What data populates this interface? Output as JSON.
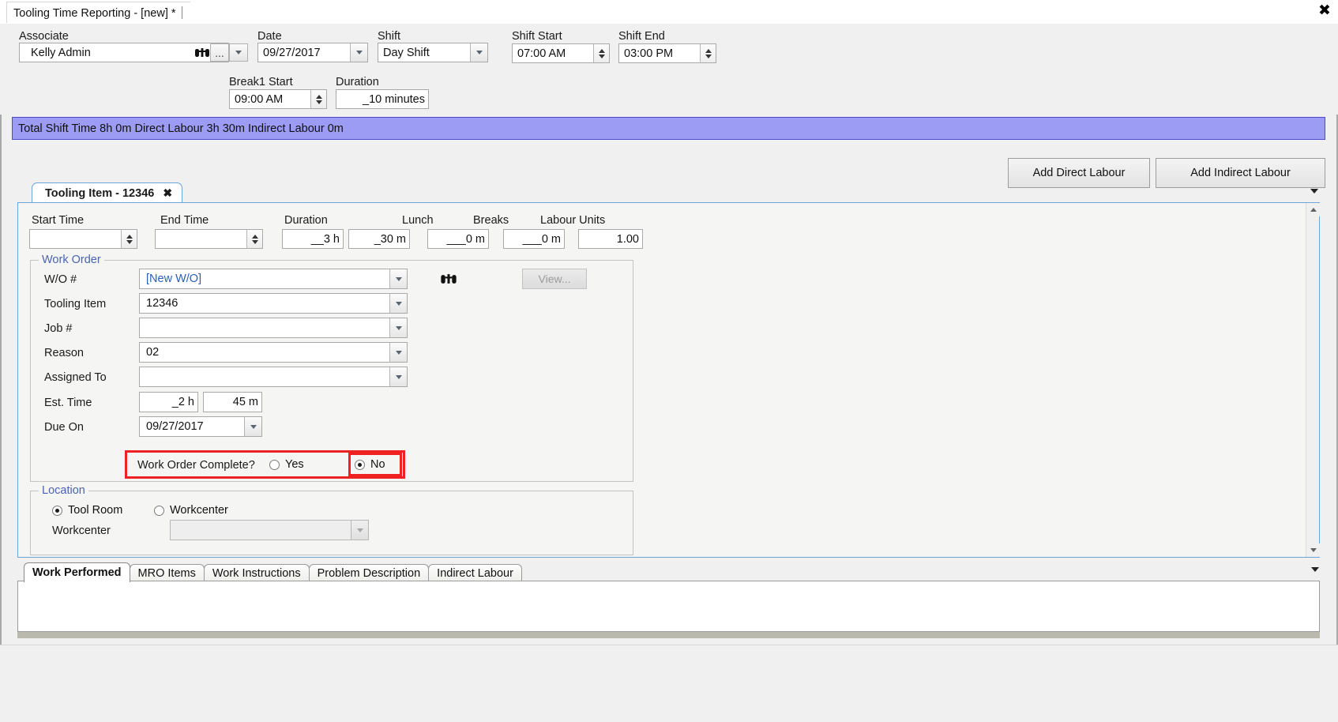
{
  "window": {
    "tab_title": "Tooling Time Reporting - [new] *",
    "close_icon": "close-icon"
  },
  "header": {
    "associate": {
      "label": "Associate",
      "value": "Kelly Admin",
      "search_icon": "binoculars-icon",
      "ellipsis_button": "...",
      "dropdown_icon": "chevron-down-icon"
    },
    "date": {
      "label": "Date",
      "value": "09/27/2017"
    },
    "shift": {
      "label": "Shift",
      "value": "Day Shift"
    },
    "shift_start": {
      "label": "Shift Start",
      "value": "07:00 AM"
    },
    "shift_end": {
      "label": "Shift End",
      "value": "03:00 PM"
    },
    "break1_start": {
      "label": "Break1 Start",
      "value": "09:00 AM"
    },
    "break1_duration": {
      "label": "Duration",
      "value": "_10 minutes"
    }
  },
  "summary": {
    "text": "Total Shift Time 8h 0m  Direct Labour 3h 30m  Indirect Labour 0m",
    "color": "#9c9cf5"
  },
  "actions": {
    "add_direct_labour": "Add Direct Labour",
    "add_indirect_labour": "Add Indirect Labour"
  },
  "item_tab": {
    "label": "Tooling Item - 12346",
    "close_glyph": "✖"
  },
  "time_row": {
    "start_time": {
      "label": "Start Time",
      "value": ""
    },
    "end_time": {
      "label": "End Time",
      "value": ""
    },
    "duration": {
      "label": "Duration",
      "hours": "__3 h",
      "minutes": "_30 m"
    },
    "lunch": {
      "label": "Lunch",
      "value": "___0 m"
    },
    "breaks": {
      "label": "Breaks",
      "value": "___0 m"
    },
    "labour_units": {
      "label": "Labour Units",
      "value": "1.00"
    }
  },
  "work_order": {
    "group_title": "Work Order",
    "wo_number": {
      "label": "W/O #",
      "value": "[New W/O]",
      "value_color": "#2c5fb8"
    },
    "search_icon": "binoculars-icon",
    "view_button": {
      "label": "View...",
      "enabled": false
    },
    "tooling_item": {
      "label": "Tooling Item",
      "value": "12346"
    },
    "job_number": {
      "label": "Job #",
      "value": ""
    },
    "reason": {
      "label": "Reason",
      "value": "02"
    },
    "assigned_to": {
      "label": "Assigned To",
      "value": ""
    },
    "est_time": {
      "label": "Est. Time",
      "hours": "_2 h",
      "minutes": "45 m"
    },
    "due_on": {
      "label": "Due On",
      "value": "09/27/2017"
    },
    "complete": {
      "label": "Work Order Complete?",
      "yes_label": "Yes",
      "no_label": "No",
      "selected": "No",
      "highlight_color": "#ee2222"
    }
  },
  "location": {
    "group_title": "Location",
    "tool_room": "Tool Room",
    "workcenter_radio": "Workcenter",
    "selected": "Tool Room",
    "workcenter_label": "Workcenter",
    "workcenter_value": ""
  },
  "bottom_tabs": {
    "items": [
      {
        "label": "Work Performed",
        "active": true
      },
      {
        "label": "MRO Items",
        "active": false
      },
      {
        "label": "Work Instructions",
        "active": false
      },
      {
        "label": "Problem Description",
        "active": false
      },
      {
        "label": "Indirect Labour",
        "active": false
      }
    ],
    "overflow_icon": "chevron-down-icon"
  },
  "editor": {
    "value": ""
  }
}
